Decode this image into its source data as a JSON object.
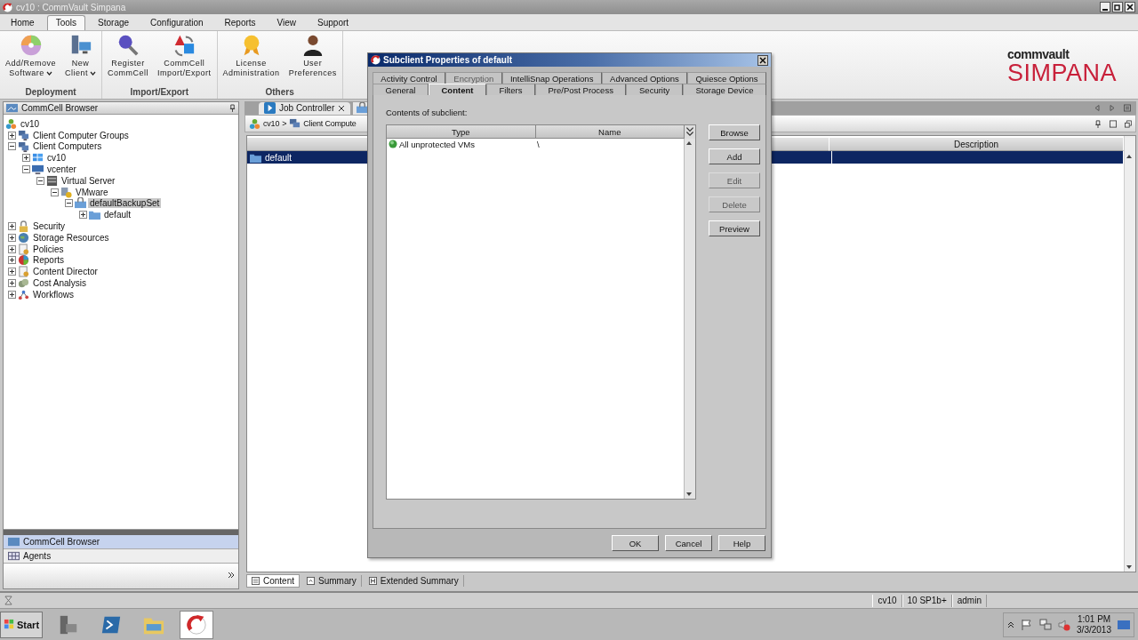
{
  "window": {
    "title": "cv10 : CommVault Simpana"
  },
  "ribbon_tabs": [
    {
      "label": "Home",
      "selected": false
    },
    {
      "label": "Tools",
      "selected": true
    },
    {
      "label": "Storage",
      "selected": false
    },
    {
      "label": "Configuration",
      "selected": false
    },
    {
      "label": "Reports",
      "selected": false
    },
    {
      "label": "View",
      "selected": false
    },
    {
      "label": "Support",
      "selected": false
    }
  ],
  "ribbon_groups": [
    {
      "label": "Deployment",
      "buttons": [
        {
          "kind": "disc",
          "lines": [
            "Add/Remove",
            "Software"
          ],
          "dropdown": true
        },
        {
          "kind": "computers",
          "lines": [
            "New",
            "Client"
          ],
          "dropdown": true
        }
      ]
    },
    {
      "label": "Import/Export",
      "buttons": [
        {
          "kind": "key",
          "lines": [
            "Register",
            "CommCell"
          ],
          "dropdown": false
        },
        {
          "kind": "arrows",
          "lines": [
            "CommCell",
            "Import/Export"
          ],
          "dropdown": false
        }
      ]
    },
    {
      "label": "Others",
      "buttons": [
        {
          "kind": "medal",
          "lines": [
            "License",
            "Administration"
          ],
          "dropdown": false
        },
        {
          "kind": "person",
          "lines": [
            "User",
            "Preferences"
          ],
          "dropdown": false
        }
      ]
    }
  ],
  "logo": {
    "brand": "commvault",
    "product": "SIMPANA"
  },
  "browser_panel": {
    "title": "CommCell Browser",
    "tree": [
      {
        "label": "cv10",
        "kind": "commcell",
        "selected": false,
        "children": [
          {
            "label": "Client Computer Groups",
            "kind": "group",
            "expanded": false,
            "selected": false
          },
          {
            "label": "Client Computers",
            "kind": "group",
            "expanded": true,
            "selected": false,
            "children": [
              {
                "label": "cv10",
                "kind": "windows",
                "expanded": false,
                "selected": false
              },
              {
                "label": "vcenter",
                "kind": "monitor",
                "expanded": true,
                "selected": false,
                "children": [
                  {
                    "label": "Virtual Server",
                    "kind": "server",
                    "expanded": true,
                    "selected": false,
                    "children": [
                      {
                        "label": "VMware",
                        "kind": "vmware",
                        "expanded": true,
                        "selected": false,
                        "children": [
                          {
                            "label": "defaultBackupSet",
                            "kind": "backupset",
                            "expanded": true,
                            "selected": true,
                            "children": [
                              {
                                "label": "default",
                                "kind": "folder",
                                "expanded": false,
                                "selected": false
                              }
                            ]
                          }
                        ]
                      }
                    ]
                  }
                ]
              }
            ]
          },
          {
            "label": "Security",
            "kind": "lock",
            "expanded": false,
            "selected": false
          },
          {
            "label": "Storage Resources",
            "kind": "globe",
            "expanded": false,
            "selected": false
          },
          {
            "label": "Policies",
            "kind": "document",
            "expanded": false,
            "selected": false
          },
          {
            "label": "Reports",
            "kind": "pie",
            "expanded": false,
            "selected": false
          },
          {
            "label": "Content Director",
            "kind": "document",
            "expanded": false,
            "selected": false
          },
          {
            "label": "Cost Analysis",
            "kind": "coins",
            "expanded": false,
            "selected": false
          },
          {
            "label": "Workflows",
            "kind": "workflow",
            "expanded": false,
            "selected": false
          }
        ]
      }
    ]
  },
  "nav_panes": [
    {
      "label": "CommCell Browser",
      "selected": true
    },
    {
      "label": "Agents",
      "selected": false
    }
  ],
  "content_tabs": [
    {
      "label": "Job Controller",
      "closable": true
    }
  ],
  "breadcrumb": {
    "items": [
      "cv10",
      "Client Compute"
    ],
    "separator": ">"
  },
  "table": {
    "columns": [
      "Description"
    ],
    "rows": [
      {
        "name": "default",
        "selected": true
      }
    ]
  },
  "bottom_tabs": [
    {
      "label": "Content",
      "selected": true
    },
    {
      "label": "Summary",
      "selected": false
    },
    {
      "label": "Extended Summary",
      "selected": false
    }
  ],
  "status_bar": {
    "cells": [
      "cv10",
      "10 SP1b+",
      "admin"
    ]
  },
  "taskbar": {
    "start": "Start",
    "time": "1:01 PM",
    "date": "3/3/2013",
    "apps": [
      {
        "kind": "server",
        "active": false
      },
      {
        "kind": "shell",
        "active": false
      },
      {
        "kind": "explorer",
        "active": false
      },
      {
        "kind": "app",
        "active": true
      }
    ]
  },
  "dialog": {
    "title": "Subclient Properties of default",
    "tab_rows": [
      [
        {
          "label": "Activity Control",
          "selected": false,
          "disabled": false
        },
        {
          "label": "Encryption",
          "selected": false,
          "disabled": true
        },
        {
          "label": "IntelliSnap Operations",
          "selected": false,
          "disabled": false
        },
        {
          "label": "Advanced Options",
          "selected": false,
          "disabled": false
        },
        {
          "label": "Quiesce Options",
          "selected": false,
          "disabled": false
        }
      ],
      [
        {
          "label": "General",
          "selected": false,
          "disabled": false
        },
        {
          "label": "Content",
          "selected": true,
          "disabled": false
        },
        {
          "label": "Filters",
          "selected": false,
          "disabled": false
        },
        {
          "label": "Pre/Post Process",
          "selected": false,
          "disabled": false
        },
        {
          "label": "Security",
          "selected": false,
          "disabled": false
        },
        {
          "label": "Storage Device",
          "selected": false,
          "disabled": false
        }
      ]
    ],
    "content_label": "Contents of subclient:",
    "columns": [
      "Type",
      "Name"
    ],
    "rows": [
      {
        "type": "All unprotected VMs",
        "name": "\\"
      }
    ],
    "side_buttons": [
      {
        "label": "Browse",
        "disabled": false
      },
      {
        "label": "Add",
        "disabled": false
      },
      {
        "label": "Edit",
        "disabled": true
      },
      {
        "label": "Delete",
        "disabled": true
      },
      {
        "label": "Preview",
        "disabled": false
      }
    ],
    "footer_buttons": [
      "OK",
      "Cancel",
      "Help"
    ]
  }
}
